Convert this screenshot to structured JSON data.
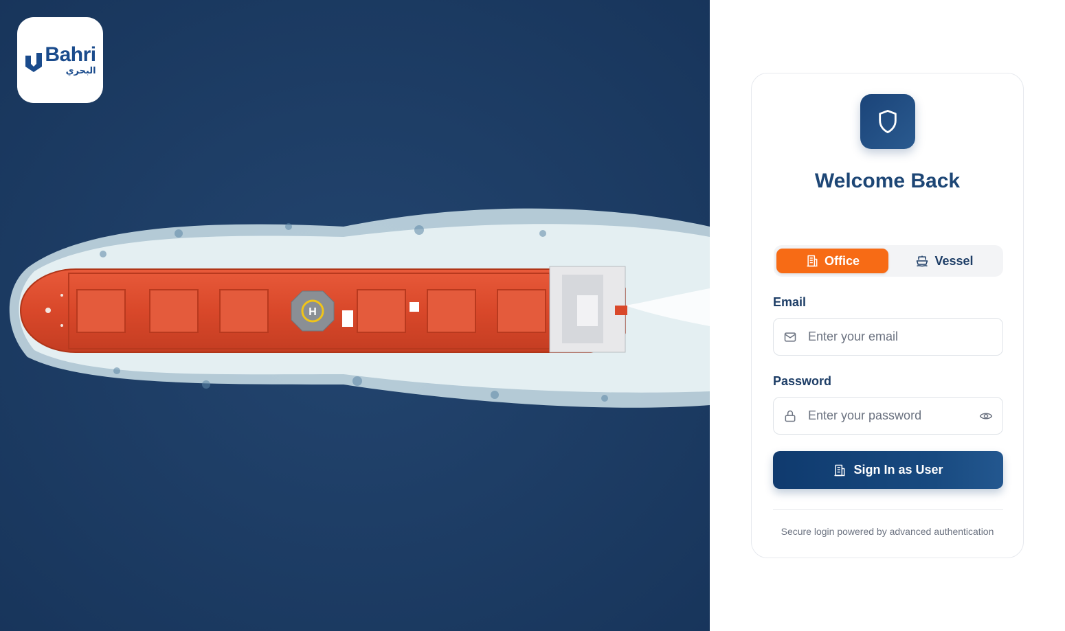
{
  "brand": {
    "name_en": "Bahri",
    "name_ar": "البحري",
    "primary_color": "#1d4675",
    "accent_color": "#f76b15"
  },
  "hero": {
    "image_description_icon": "ship-aerial-image"
  },
  "card": {
    "header_icon": "shield-icon",
    "title": "Welcome Back",
    "tabs": [
      {
        "label": "Office",
        "icon": "building-icon",
        "active": true
      },
      {
        "label": "Vessel",
        "icon": "ship-icon",
        "active": false
      }
    ],
    "email": {
      "label": "Email",
      "placeholder": "Enter your email",
      "value": "",
      "icon": "mail-icon"
    },
    "password": {
      "label": "Password",
      "placeholder": "Enter your password",
      "value": "",
      "icon": "lock-icon",
      "toggle_icon": "eye-icon"
    },
    "submit": {
      "label": "Sign In as User",
      "icon": "building-icon"
    },
    "footnote": "Secure login powered by advanced authentication"
  }
}
